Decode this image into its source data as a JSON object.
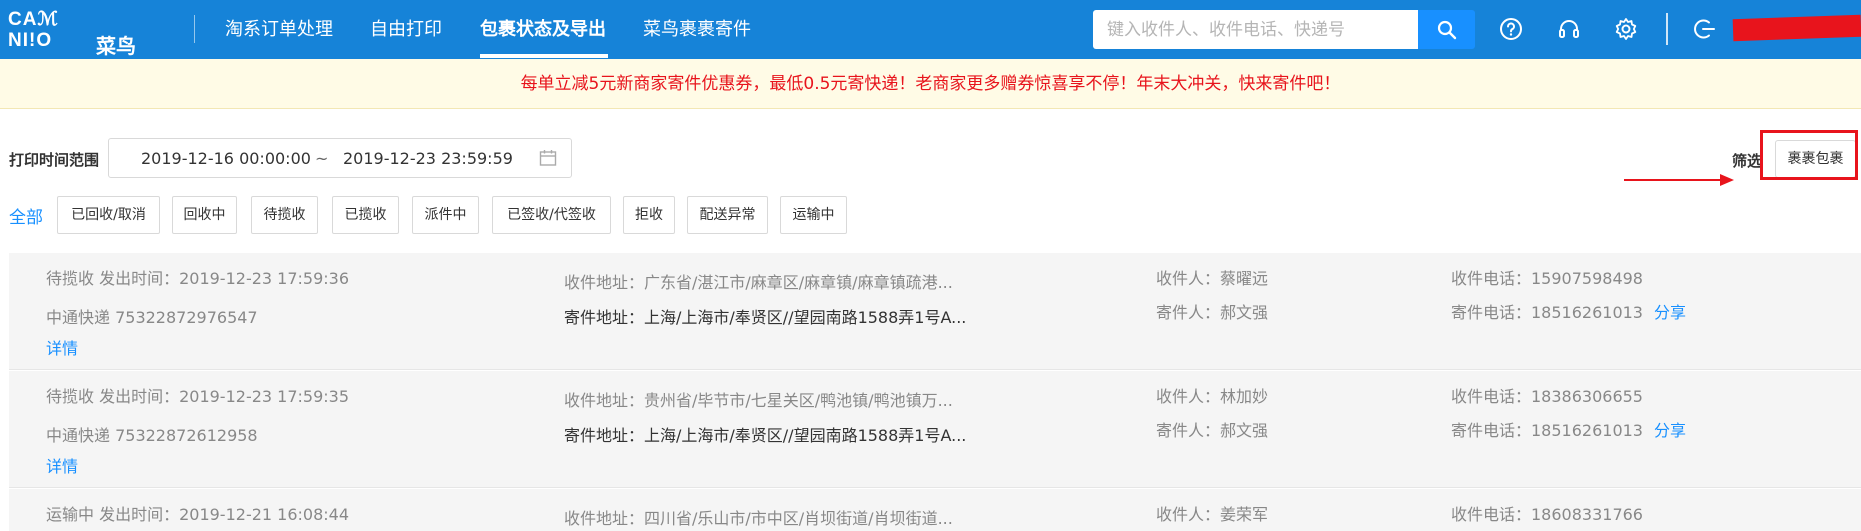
{
  "logo": {
    "line1": "CAℳ",
    "line2": "NI!O",
    "cn": "菜鸟"
  },
  "nav": {
    "items": [
      {
        "label": "淘系订单处理"
      },
      {
        "label": "自由打印"
      },
      {
        "label": "包裹状态及导出"
      },
      {
        "label": "菜鸟裹裹寄件"
      }
    ],
    "active_index": 2
  },
  "search": {
    "placeholder": "键入收件人、收件电话、快递号"
  },
  "icons": [
    "search-icon",
    "help-icon",
    "headset-icon",
    "gear-icon",
    "logout-icon"
  ],
  "banner": {
    "text": "每单立减5元新商家寄件优惠券，最低0.5元寄快递！老商家更多赠券惊喜享不停！年末大冲关，快来寄件吧！"
  },
  "filter": {
    "range_label": "打印时间范围",
    "start": "2019-12-16 00:00:00",
    "separator": "~",
    "end": "2019-12-23 23:59:59",
    "screen_label": "筛选",
    "screen_button": "裹裹包裹"
  },
  "status_tabs": {
    "all": "全部",
    "tags": [
      "已回收/取消",
      "回收中",
      "待揽收",
      "已揽收",
      "派件中",
      "已签收/代签收",
      "拒收",
      "配送异常",
      "运输中"
    ]
  },
  "packages": [
    {
      "status_time": "待揽收 发出时间：2019-12-23 17:59:36",
      "carrier": "中通快递 75322872976547",
      "detail": "详情",
      "recv_addr": "收件地址：广东省/湛江市/麻章区/麻章镇/麻章镇疏港...",
      "send_addr": "寄件地址：上海/上海市/奉贤区//望园南路1588弄1号A...",
      "recv_name": "收件人：蔡曜远",
      "send_name": "寄件人：郝文强",
      "recv_phone": "收件电话：15907598498",
      "send_phone": "寄件电话：18516261013",
      "share": "分享"
    },
    {
      "status_time": "待揽收 发出时间：2019-12-23 17:59:35",
      "carrier": "中通快递 75322872612958",
      "detail": "详情",
      "recv_addr": "收件地址：贵州省/毕节市/七星关区/鸭池镇/鸭池镇万...",
      "send_addr": "寄件地址：上海/上海市/奉贤区//望园南路1588弄1号A...",
      "recv_name": "收件人：林加妙",
      "send_name": "寄件人：郝文强",
      "recv_phone": "收件电话：18386306655",
      "send_phone": "寄件电话：18516261013",
      "share": "分享"
    },
    {
      "status_time": "运输中 发出时间：2019-12-21 16:08:44",
      "recv_addr": "收件地址：四川省/乐山市/市中区/肖坝街道/肖坝街道...",
      "recv_name": "收件人：姜荣军",
      "recv_phone": "收件电话：18608331766"
    }
  ],
  "colors": {
    "nav_bg": "#1683d8",
    "accent": "#1890ff",
    "banner_text": "#e8141c",
    "highlight": "#e8141c"
  }
}
